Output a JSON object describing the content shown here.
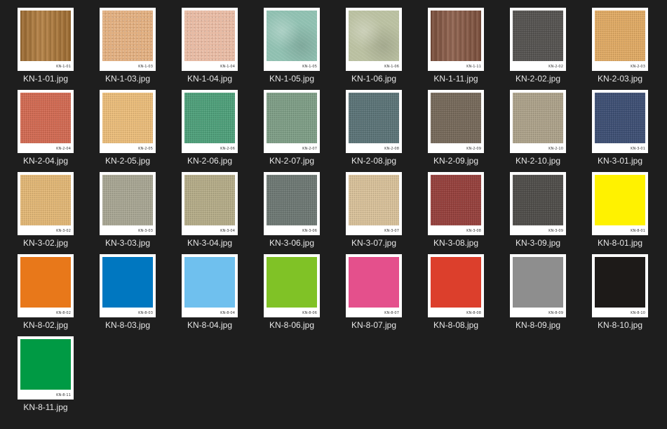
{
  "files": [
    {
      "name": "KN-1-01.jpg",
      "code": "KN-1-01",
      "color": "#b07a3a",
      "texture": "wood"
    },
    {
      "name": "KN-1-03.jpg",
      "code": "KN-1-03",
      "color": "#e0ad7e",
      "texture": "speckle"
    },
    {
      "name": "KN-1-04.jpg",
      "code": "KN-1-04",
      "color": "#e7b9a2",
      "texture": "speckle"
    },
    {
      "name": "KN-1-05.jpg",
      "code": "KN-1-05",
      "color": "#8fbfb0",
      "texture": "marble"
    },
    {
      "name": "KN-1-06.jpg",
      "code": "KN-1-06",
      "color": "#b9bfa0",
      "texture": "marble"
    },
    {
      "name": "KN-1-11.jpg",
      "code": "KN-1-11",
      "color": "#8a5a45",
      "texture": "wood"
    },
    {
      "name": "KN-2-02.jpg",
      "code": "KN-2-02",
      "color": "#555350",
      "texture": "grain"
    },
    {
      "name": "KN-2-03.jpg",
      "code": "KN-2-03",
      "color": "#e0aa64",
      "texture": "grain"
    },
    {
      "name": "KN-2-04.jpg",
      "code": "KN-2-04",
      "color": "#d26a52",
      "texture": "grain"
    },
    {
      "name": "KN-2-05.jpg",
      "code": "KN-2-05",
      "color": "#ebbd7a",
      "texture": "grain"
    },
    {
      "name": "KN-2-06.jpg",
      "code": "KN-2-06",
      "color": "#4ea07a",
      "texture": "grain"
    },
    {
      "name": "KN-2-07.jpg",
      "code": "KN-2-07",
      "color": "#7e9e86",
      "texture": "grain"
    },
    {
      "name": "KN-2-08.jpg",
      "code": "KN-2-08",
      "color": "#5b7377",
      "texture": "grain"
    },
    {
      "name": "KN-2-09.jpg",
      "code": "KN-2-09",
      "color": "#76695a",
      "texture": "grain"
    },
    {
      "name": "KN-2-10.jpg",
      "code": "KN-2-10",
      "color": "#ada28a",
      "texture": "grain"
    },
    {
      "name": "KN-3-01.jpg",
      "code": "KN-3-01",
      "color": "#3d4f73",
      "texture": "grain"
    },
    {
      "name": "KN-3-02.jpg",
      "code": "KN-3-02",
      "color": "#e2b775",
      "texture": "grain"
    },
    {
      "name": "KN-3-03.jpg",
      "code": "KN-3-03",
      "color": "#a8a693",
      "texture": "grain"
    },
    {
      "name": "KN-3-04.jpg",
      "code": "KN-3-04",
      "color": "#b5ac88",
      "texture": "grain"
    },
    {
      "name": "KN-3-06.jpg",
      "code": "KN-3-06",
      "color": "#6d7873",
      "texture": "grain"
    },
    {
      "name": "KN-3-07.jpg",
      "code": "KN-3-07",
      "color": "#d9c19a",
      "texture": "grain"
    },
    {
      "name": "KN-3-08.jpg",
      "code": "KN-3-08",
      "color": "#96403c",
      "texture": "grain"
    },
    {
      "name": "KN-3-09.jpg",
      "code": "KN-3-09",
      "color": "#4f4d49",
      "texture": "grain"
    },
    {
      "name": "KN-8-01.jpg",
      "code": "KN-8-01",
      "color": "#fff200",
      "texture": "solid"
    },
    {
      "name": "KN-8-02.jpg",
      "code": "KN-8-02",
      "color": "#e8781a",
      "texture": "solid"
    },
    {
      "name": "KN-8-03.jpg",
      "code": "KN-8-03",
      "color": "#0077c0",
      "texture": "solid"
    },
    {
      "name": "KN-8-04.jpg",
      "code": "KN-8-04",
      "color": "#6fc0ee",
      "texture": "solid"
    },
    {
      "name": "KN-8-06.jpg",
      "code": "KN-8-06",
      "color": "#80c226",
      "texture": "solid"
    },
    {
      "name": "KN-8-07.jpg",
      "code": "KN-8-07",
      "color": "#e4508c",
      "texture": "solid"
    },
    {
      "name": "KN-8-08.jpg",
      "code": "KN-8-08",
      "color": "#dc3f2c",
      "texture": "solid"
    },
    {
      "name": "KN-8-09.jpg",
      "code": "KN-8-09",
      "color": "#8e8e8e",
      "texture": "solid"
    },
    {
      "name": "KN-8-10.jpg",
      "code": "KN-8-10",
      "color": "#1d1a18",
      "texture": "solid"
    },
    {
      "name": "KN-8-11.jpg",
      "code": "KN-8-11",
      "color": "#009a44",
      "texture": "solid"
    }
  ]
}
